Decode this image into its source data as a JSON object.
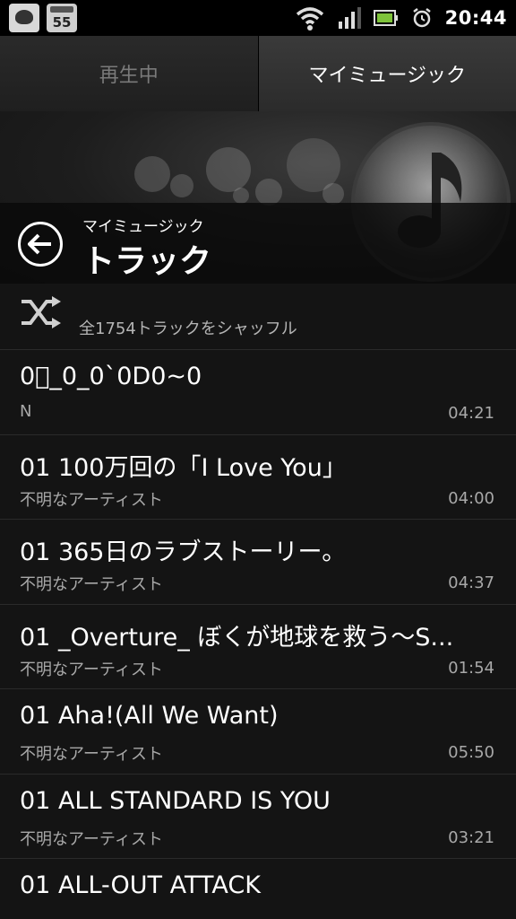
{
  "status_bar": {
    "calendar_date": "55",
    "time": "20:44",
    "icons": [
      "notification-bird-icon",
      "calendar-icon",
      "wifi-icon",
      "signal-icon",
      "battery-icon",
      "alarm-icon"
    ]
  },
  "tabs": [
    {
      "label": "再生中",
      "active": false
    },
    {
      "label": "マイミュージック",
      "active": true
    }
  ],
  "header": {
    "breadcrumb": "マイミュージック",
    "title": "トラック"
  },
  "shuffle": {
    "label": "全1754トラックをシャッフル"
  },
  "tracks": [
    {
      "title": "0\u0000_0_0`0D0~0",
      "artist": "N",
      "duration": "04:21"
    },
    {
      "title": "01 100万回の「I Love You」",
      "artist": "不明なアーティスト",
      "duration": "04:00"
    },
    {
      "title": "01 365日のラブストーリー。",
      "artist": "不明なアーティスト",
      "duration": "04:37"
    },
    {
      "title": "01 _Overture_ ぼくが地球を救う～S...",
      "artist": "不明なアーティスト",
      "duration": "01:54"
    },
    {
      "title": "01 Aha!(All We Want)",
      "artist": "不明なアーティスト",
      "duration": "05:50"
    },
    {
      "title": "01 ALL STANDARD IS YOU",
      "artist": "不明なアーティスト",
      "duration": "03:21"
    },
    {
      "title": "01 ALL-OUT ATTACK",
      "artist": "",
      "duration": ""
    }
  ],
  "colors": {
    "background": "#141414",
    "secondary_text": "#a8a8a8",
    "divider": "#2a2a2a"
  }
}
